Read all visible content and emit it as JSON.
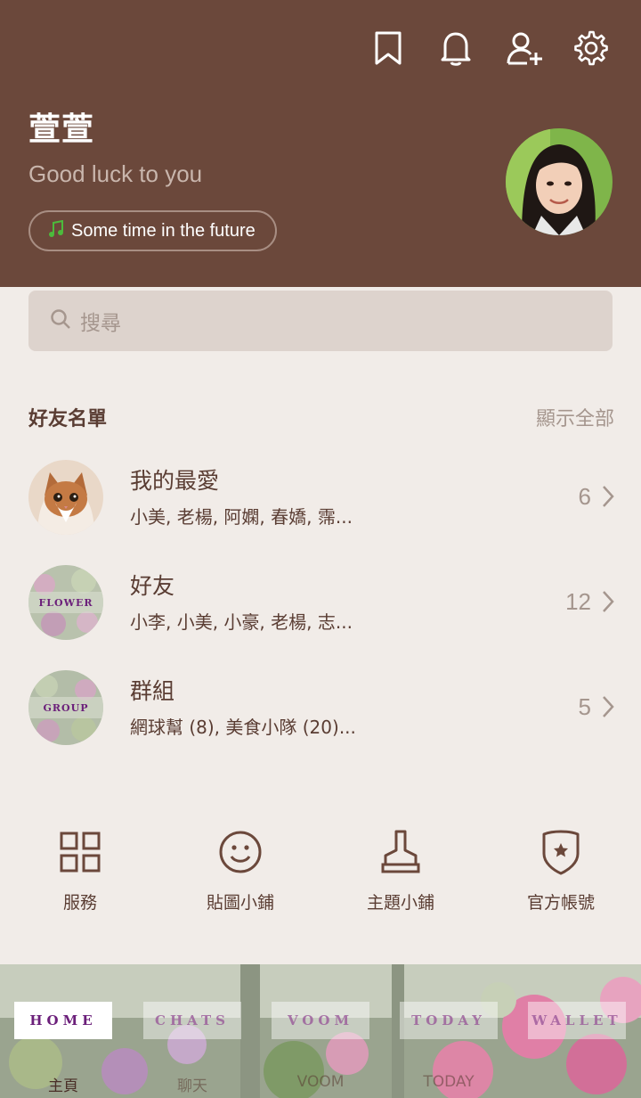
{
  "profile": {
    "name": "萱萱",
    "status_message": "Good luck to you",
    "music": "Some time in the future"
  },
  "header_icons": [
    "bookmark-icon",
    "bell-icon",
    "add-friend-icon",
    "settings-icon"
  ],
  "search": {
    "placeholder": "搜尋"
  },
  "friends_section": {
    "title": "好友名單",
    "show_all": "顯示全部",
    "rows": [
      {
        "title": "我的最愛",
        "subtitle": "小美, 老楊, 阿嫻, 春嬌, 霈...",
        "count": "6"
      },
      {
        "title": "好友",
        "subtitle": "小李, 小美, 小豪, 老楊, 志...",
        "count": "12",
        "thumb_text": "FLOWER"
      },
      {
        "title": "群組",
        "subtitle": "網球幫 (8), 美食小隊 (20)...",
        "count": "5",
        "thumb_text": "GROUP"
      }
    ]
  },
  "shortcuts": [
    {
      "label": "服務",
      "icon": "grid-icon"
    },
    {
      "label": "貼圖小鋪",
      "icon": "smiley-icon"
    },
    {
      "label": "主題小鋪",
      "icon": "brush-icon"
    },
    {
      "label": "官方帳號",
      "icon": "shield-star-icon"
    }
  ],
  "bottom_nav": [
    {
      "label": "HOME",
      "sub": "主頁",
      "active": true
    },
    {
      "label": "CHATS",
      "sub": "聊天",
      "active": false
    },
    {
      "label": "VOOM",
      "sub": "VOOM",
      "active": false
    },
    {
      "label": "TODAY",
      "sub": "TODAY",
      "active": false
    },
    {
      "label": "WALLET",
      "sub": "",
      "active": false
    }
  ],
  "colors": {
    "header_bg": "#6b483b",
    "page_bg": "#f1ece8",
    "search_bg": "#ddd3cd",
    "text_brown": "#5a3d33",
    "muted": "#a5968e",
    "music_note": "#4cbb3c",
    "active_tab_text": "#6b1f7a"
  }
}
